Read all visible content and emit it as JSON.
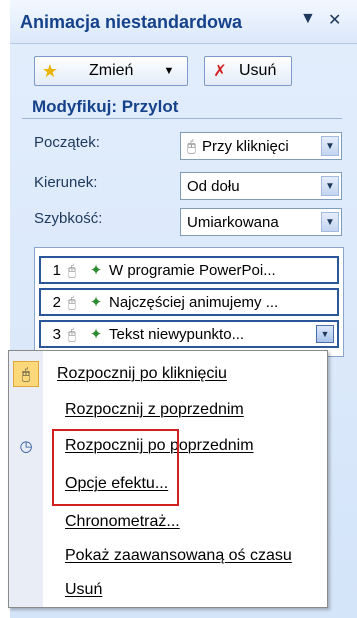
{
  "pane": {
    "title": "Animacja niestandardowa",
    "title_dropdown_icon": "▼",
    "title_close_icon": "✕"
  },
  "toolbar": {
    "change_label": "Zmień",
    "change_icon": "star-icon",
    "remove_label": "Usuń",
    "remove_icon": "remove-effect-icon"
  },
  "modify": {
    "heading": "Modyfikuj: Przylot",
    "start_label": "Początek:",
    "start_value": "Przy kliknięci",
    "direction_label": "Kierunek:",
    "direction_value": "Od dołu",
    "speed_label": "Szybkość:",
    "speed_value": "Umiarkowana"
  },
  "effects_list": [
    {
      "number": "1",
      "text": "W programie PowerPoi..."
    },
    {
      "number": "2",
      "text": "Najczęściej animujemy ..."
    },
    {
      "number": "3",
      "text": "Tekst niewypunkto..."
    }
  ],
  "context_menu": [
    {
      "label": "Rozpocznij po kliknięciu",
      "icon": "mouse-icon",
      "checked": true
    },
    {
      "label": "Rozpocznij z poprzednim",
      "icon": "",
      "checked": false
    },
    {
      "label": "Rozpocznij po poprzednim",
      "icon": "clock-icon",
      "checked": false
    },
    {
      "label": "Opcje efektu...",
      "icon": "",
      "checked": false
    },
    {
      "label": "Chronometraż...",
      "icon": "",
      "checked": false
    },
    {
      "label": "Pokaż zaawansowaną oś czasu",
      "icon": "",
      "checked": false
    },
    {
      "label": "Usuń",
      "icon": "",
      "checked": false
    }
  ],
  "colors": {
    "pane_bg": "#dbe8fa",
    "title_text": "#15428b",
    "highlight_box": "#d02020",
    "checked_item_bg": "#fbd97a"
  }
}
